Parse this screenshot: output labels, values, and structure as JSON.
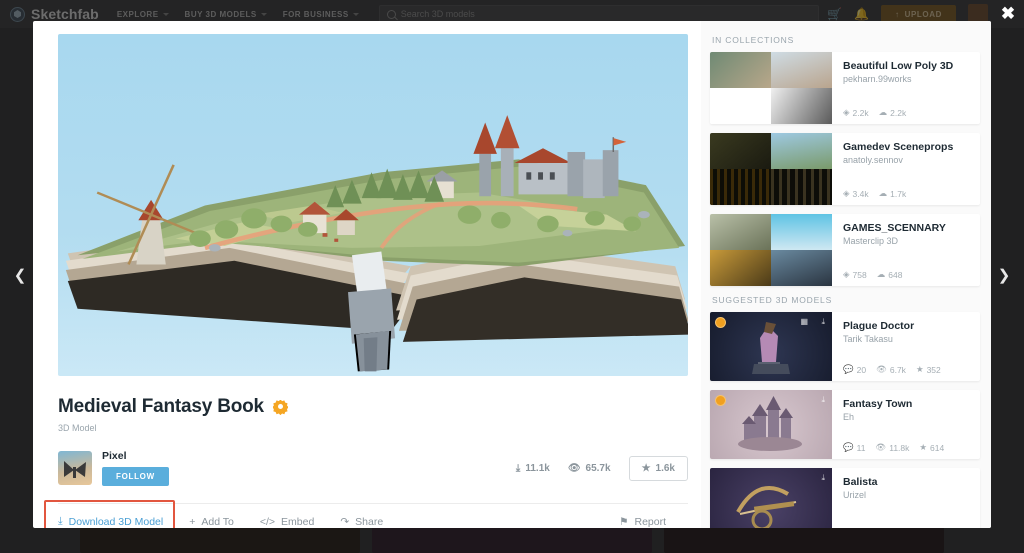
{
  "topnav": {
    "brand": "Sketchfab",
    "links": [
      {
        "label": "EXPLORE",
        "caret": true
      },
      {
        "label": "BUY 3D MODELS",
        "caret": true
      },
      {
        "label": "FOR BUSINESS",
        "caret": true
      }
    ],
    "search_placeholder": "Search 3D models",
    "cart_icon": "cart-icon",
    "bell_icon": "bell-icon",
    "upload_label": "UPLOAD",
    "upload_icon": "upload-arrow-icon",
    "avatar_icon": "user-avatar",
    "close_icon": "close-icon",
    "prev_icon": "chevron-left-icon",
    "next_icon": "chevron-right-icon",
    "colors": {
      "upload_bg": "#7a5a23",
      "bar_bg": "#38383a"
    }
  },
  "model": {
    "title": "Medieval Fantasy Book",
    "badge_icon": "staff-pick-badge",
    "subtitle": "3D Model",
    "author": "Pixel",
    "follow_label": "FOLLOW",
    "stats": {
      "downloads": "11.1k",
      "views": "65.7k",
      "likes": "1.6k",
      "download_icon": "download-icon",
      "views_icon": "eye-icon",
      "likes_icon": "star-icon"
    },
    "actions": [
      {
        "label": "Download 3D Model",
        "icon": "download-icon",
        "primary": true,
        "highlighted": true
      },
      {
        "label": "Add To",
        "icon": "plus-icon",
        "primary": false,
        "highlighted": false
      },
      {
        "label": "Embed",
        "icon": "code-icon",
        "primary": false,
        "highlighted": false
      },
      {
        "label": "Share",
        "icon": "share-arrow-icon",
        "primary": false,
        "highlighted": false
      }
    ],
    "report_label": "Report",
    "report_icon": "flag-icon",
    "colors": {
      "link": "#4a9fd4",
      "follow": "#5aaedc",
      "badge": "#f5a623",
      "highlight": "#e2563f"
    }
  },
  "viewer": {
    "scene_name": "medieval-fantasy-book-3d-scene",
    "sky_color": "#a8d8ef"
  },
  "sidebar": {
    "collections_heading": "IN COLLECTIONS",
    "collections": [
      {
        "title": "Beautiful Low Poly 3D",
        "author": "pekharn.99works",
        "models": "2.2k",
        "followers": "2.2k",
        "models_icon": "cube-icon",
        "followers_icon": "rss-icon",
        "thumbs": [
          "#8fa6a0",
          "#cdd8e0",
          "#ffffff",
          "#d8d8d8"
        ]
      },
      {
        "title": "Gamedev Sceneprops",
        "author": "anatoly.sennov",
        "models": "3.4k",
        "followers": "1.7k",
        "models_icon": "cube-icon",
        "followers_icon": "rss-icon",
        "thumbs": [
          "#2a2a18",
          "#9ec9e2",
          "#231a08",
          "#1a1a1a"
        ]
      },
      {
        "title": "GAMES_SCENNARY",
        "author": "Masterclip 3D",
        "models": "758",
        "followers": "648",
        "models_icon": "cube-icon",
        "followers_icon": "rss-icon",
        "thumbs": [
          "#9aa08a",
          "#5fc3e4",
          "#8a6a23",
          "#3a4a58"
        ]
      }
    ],
    "suggested_heading": "SUGGESTED 3D MODELS",
    "suggested": [
      {
        "title": "Plague Doctor",
        "author": "Tarik Takasu",
        "comments": "20",
        "views": "6.7k",
        "likes": "352",
        "comments_icon": "comment-icon",
        "views_icon": "eye-icon",
        "likes_icon": "star-icon",
        "thumb_color": "#1e2338",
        "pin": true,
        "icons": [
          "grid-icon",
          "download-icon"
        ]
      },
      {
        "title": "Fantasy Town",
        "author": "Eh",
        "comments": "11",
        "views": "11.8k",
        "likes": "614",
        "comments_icon": "comment-icon",
        "views_icon": "eye-icon",
        "likes_icon": "star-icon",
        "thumb_color": "#c4b3bb",
        "pin": true,
        "icons": [
          "download-icon"
        ]
      },
      {
        "title": "Balista",
        "author": "Urizel",
        "comments": "",
        "views": "",
        "likes": "",
        "comments_icon": "comment-icon",
        "views_icon": "eye-icon",
        "likes_icon": "star-icon",
        "thumb_color": "#3b3350",
        "pin": false,
        "icons": [
          "download-icon"
        ]
      }
    ]
  },
  "background": {
    "card_colors": [
      "#241c16",
      "#2a1a26",
      "#1f1418"
    ]
  }
}
